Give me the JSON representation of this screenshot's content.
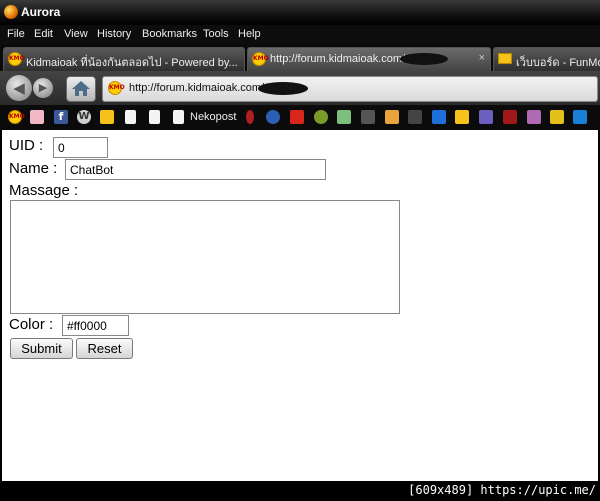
{
  "window": {
    "title": "Aurora"
  },
  "menu": [
    "File",
    "Edit",
    "View",
    "History",
    "Bookmarks",
    "Tools",
    "Help"
  ],
  "tabs": [
    {
      "label": "Kidmaioak ที่น้องกันตลอดไป - Powered by...",
      "active": false,
      "favicon": "kmo-icon"
    },
    {
      "label": "http://forum.kidmaioak.com/",
      "active": true,
      "favicon": "kmo-icon",
      "close": "×"
    },
    {
      "label": "เว็บบอร์ด - FunMo",
      "active": false,
      "favicon": "envelope-icon"
    }
  ],
  "address": {
    "url": "http://forum.kidmaioak.com/"
  },
  "bookmarks": {
    "label": "Nekopost"
  },
  "form": {
    "uid_label": "UID :",
    "uid_value": "0",
    "name_label": "Name :",
    "name_value": "ChatBot",
    "message_label": "Massage :",
    "message_value": "",
    "color_label": "Color :",
    "color_value": "#ff0000",
    "submit_label": "Submit",
    "reset_label": "Reset"
  },
  "watermark": "[609x489] https://upic.me/",
  "colors": {
    "chrome_dark": "#0d0d0d",
    "page_background": "#ffffff",
    "kmo_favicon": "#ffcc00"
  }
}
